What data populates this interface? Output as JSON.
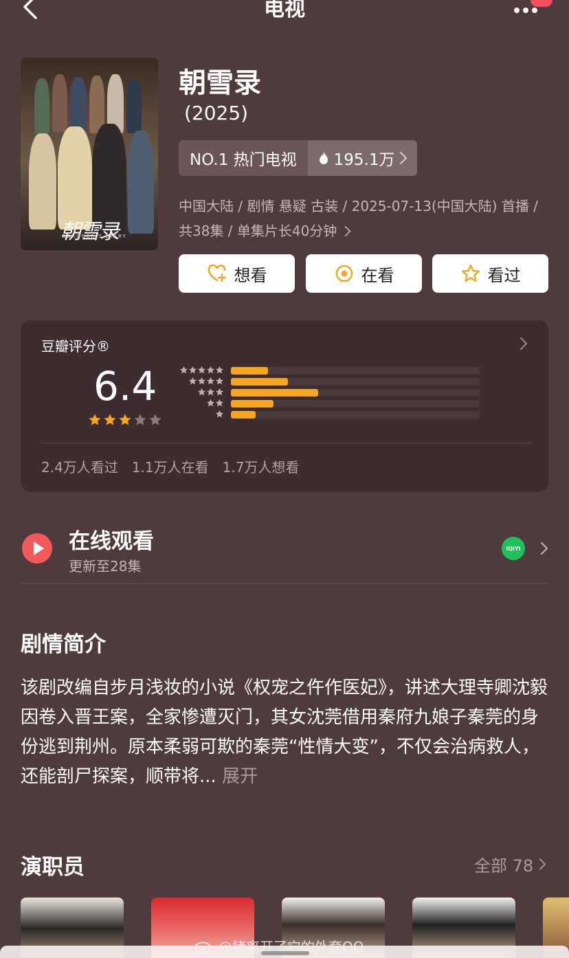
{
  "header": {
    "title": "电视",
    "back_icon": "chevron-left-icon",
    "more_icon": "more-dots-icon"
  },
  "show": {
    "title": "朝雪录",
    "year": "(2025)",
    "poster_logo": "朝雪录",
    "poster_subtitle": "CORONER'S DIARY",
    "rank_label": "NO.1 热门电视",
    "heat": "195.1万",
    "meta": "中国大陆 / 剧情 悬疑 古装 / 2025-07-13(中国大陆) 首播 / 共38集 / 单集片长40分钟"
  },
  "actions": {
    "want": "想看",
    "watching": "在看",
    "watched": "看过"
  },
  "rating": {
    "label": "豆瓣评分®",
    "score": "6.4",
    "stars_filled": 3,
    "stars_total": 5,
    "distribution": [
      {
        "stars": 5,
        "fraction": 0.15
      },
      {
        "stars": 4,
        "fraction": 0.23
      },
      {
        "stars": 3,
        "fraction": 0.35
      },
      {
        "stars": 2,
        "fraction": 0.17
      },
      {
        "stars": 1,
        "fraction": 0.1
      }
    ],
    "watched_count": "2.4万人看过",
    "watching_count": "1.1万人在看",
    "want_count": "1.7万人想看",
    "bar_color": "#f5a623",
    "star_color": "#f5a623"
  },
  "online": {
    "title": "在线观看",
    "subtitle": "更新至28集",
    "platform_label": "iQIYI 爱奇艺"
  },
  "synopsis": {
    "heading": "剧情简介",
    "text": "该剧改编自步月浅妆的小说《权宠之仵作医妃》，讲述大理寺卿沈毅因卷入晋王案，全家惨遭灭门，其女沈莞借用秦府九娘子秦莞的身份逃到荆州。原本柔弱可欺的秦莞“性情大变”，不仅会治病救人，还能剖尸探案，顺带将...",
    "expand": "展开"
  },
  "cast": {
    "heading": "演职员",
    "all_label": "全部 78"
  },
  "watermark": "@猪离开了它的外套OO"
}
